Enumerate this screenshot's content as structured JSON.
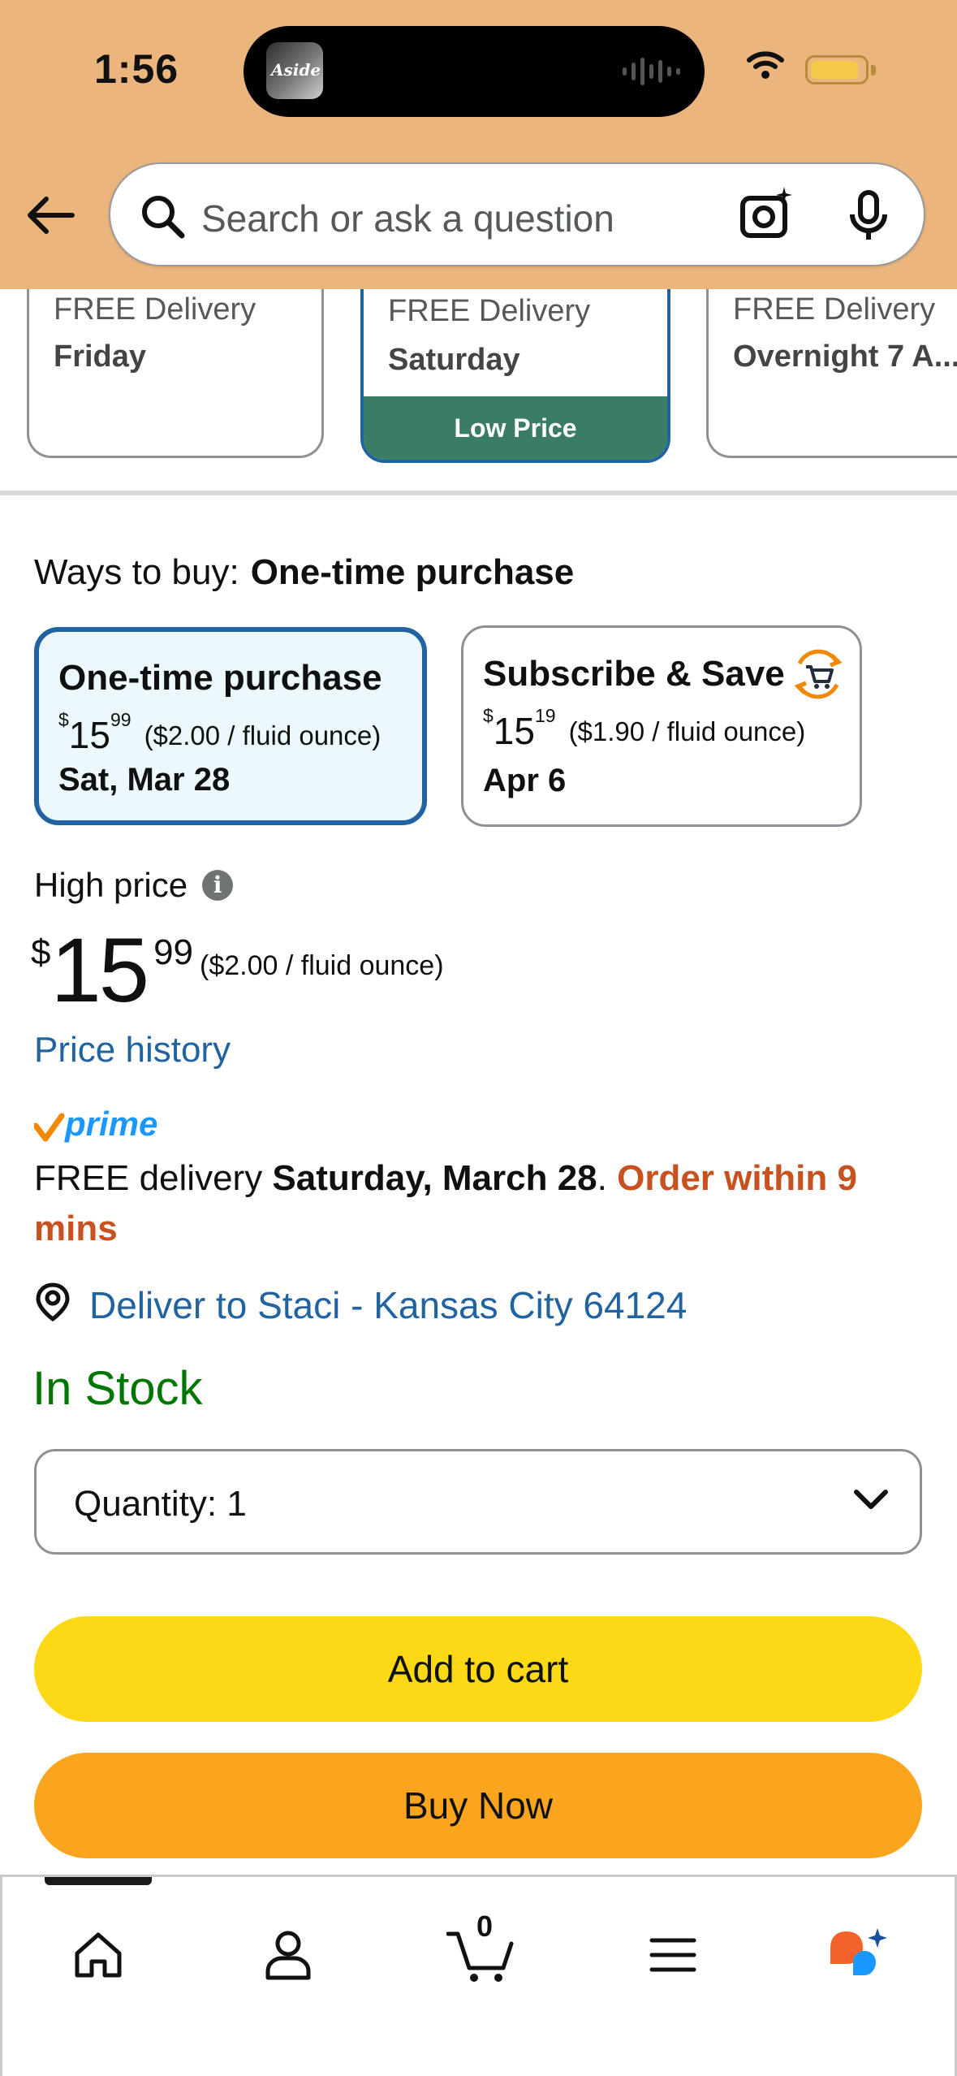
{
  "status_bar": {
    "time": "1:56",
    "now_playing_thumb": "Aside"
  },
  "search": {
    "placeholder": "Search or ask a question"
  },
  "delivery_options": [
    {
      "line1": "FREE Delivery",
      "line2": "Friday",
      "badge": ""
    },
    {
      "line1": "FREE Delivery",
      "line2": "Saturday",
      "badge": "Low Price"
    },
    {
      "line1": "FREE Delivery",
      "line2": "Overnight 7 A...",
      "badge": ""
    }
  ],
  "ways_to_buy": {
    "label": "Ways to buy:",
    "selected": "One-time purchase"
  },
  "purchase_options": [
    {
      "title": "One-time purchase",
      "dollars": "15",
      "cents": "99",
      "unit": "($2.00 / fluid ounce)",
      "date": "Sat, Mar 28",
      "selected": true
    },
    {
      "title": "Subscribe & Save",
      "dollars": "15",
      "cents": "19",
      "unit": "($1.90 / fluid ounce)",
      "date": "Apr 6",
      "selected": false
    }
  ],
  "price": {
    "label": "High price",
    "currency": "$",
    "dollars": "15",
    "cents": "99",
    "unit": "($2.00 / fluid ounce)",
    "history_link": "Price history"
  },
  "prime": {
    "logo_text": "prime"
  },
  "delivery": {
    "prefix": "FREE delivery ",
    "date": "Saturday, March 28",
    "sep": ". ",
    "urgency": "Order within 9 mins"
  },
  "location": {
    "text": "Deliver to Staci - Kansas City 64124"
  },
  "stock": {
    "status": "In Stock"
  },
  "quantity": {
    "label": "Quantity:",
    "value": "1"
  },
  "actions": {
    "add_to_cart": "Add to cart",
    "buy_now": "Buy Now"
  },
  "bottom_nav": {
    "cart_count": "0",
    "items": [
      "home-icon",
      "account-icon",
      "cart-icon",
      "menu-icon",
      "rufus-ai-icon"
    ]
  },
  "colors": {
    "header": "#ebb67e",
    "link": "#2162a1",
    "in_stock": "#007600",
    "urgency": "#c7511f",
    "add_to_cart": "#fcd914",
    "buy_now": "#fba51f",
    "low_price_badge": "#3b7c66"
  }
}
